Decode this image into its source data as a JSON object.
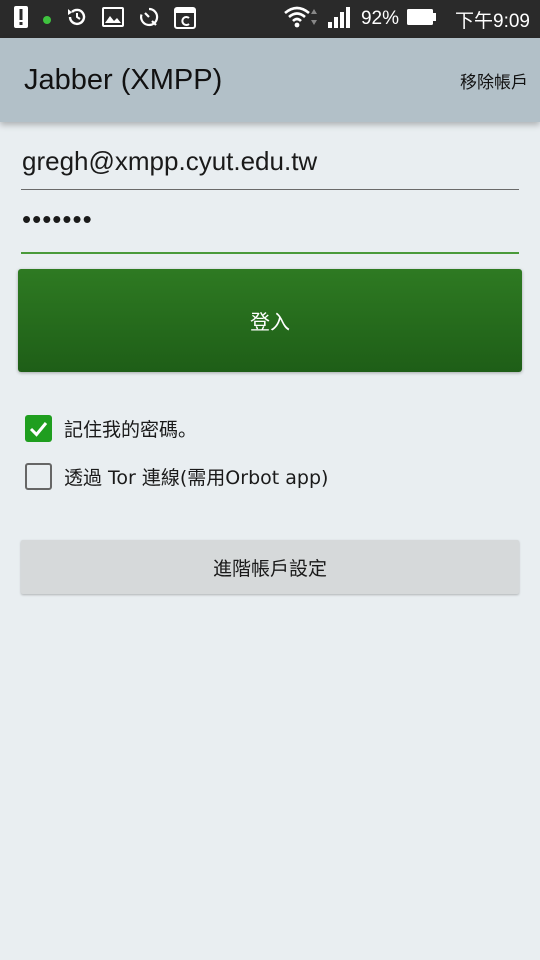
{
  "status_bar": {
    "icons": [
      "alert-icon",
      "notification-dot-icon",
      "sync-icon",
      "image-icon",
      "timer-icon",
      "calendar-icon"
    ],
    "battery_percent": "92%",
    "time": "下午9:09"
  },
  "app_bar": {
    "title": "Jabber (XMPP)",
    "action_label": "移除帳戶"
  },
  "form": {
    "username_value": "gregh@xmpp.cyut.edu.tw",
    "password_value": "•••••••",
    "login_label": "登入",
    "remember_label": "記住我的密碼。",
    "remember_checked": true,
    "tor_label": "透過 Tor 連線(需用Orbot app)",
    "tor_checked": false,
    "advanced_label": "進階帳戶設定"
  },
  "colors": {
    "status_bar": "#2a2a2a",
    "app_bar": "#b2c0c8",
    "background": "#e9eef1",
    "login_button": "#2a6e1f",
    "checkbox_checked": "#1f9e1f",
    "focus_underline": "#4a9a3a",
    "advanced_button": "#d6d9da"
  }
}
